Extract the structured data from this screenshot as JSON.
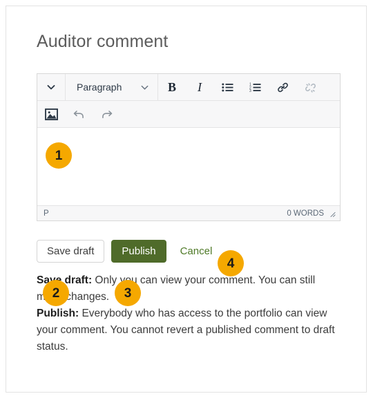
{
  "page": {
    "title": "Auditor comment"
  },
  "editor": {
    "toolbar_row1": [
      {
        "name": "block-collapse-toggle",
        "icon": "chevron-down-icon",
        "label": ""
      },
      {
        "name": "paragraph-format-select",
        "icon": "chevron-down-icon",
        "label": "Paragraph"
      },
      {
        "name": "bold-button",
        "icon": "bold-icon",
        "label": "B"
      },
      {
        "name": "italic-button",
        "icon": "italic-icon",
        "label": "I"
      },
      {
        "name": "bulleted-list-button",
        "icon": "bulleted-list-icon",
        "label": ""
      },
      {
        "name": "numbered-list-button",
        "icon": "numbered-list-icon",
        "label": ""
      },
      {
        "name": "insert-link-button",
        "icon": "link-icon",
        "label": ""
      },
      {
        "name": "unlink-button",
        "icon": "unlink-icon",
        "label": ""
      }
    ],
    "toolbar_row2": [
      {
        "name": "insert-image-button",
        "icon": "image-icon",
        "label": ""
      },
      {
        "name": "undo-button",
        "icon": "undo-icon",
        "label": ""
      },
      {
        "name": "redo-button",
        "icon": "redo-icon",
        "label": ""
      }
    ],
    "textarea_value": "",
    "textarea_placeholder": "",
    "status": {
      "element_path": "P",
      "word_count": "0 WORDS",
      "resize_grip": "resize-grip-icon"
    }
  },
  "actions": {
    "save_draft_label": "Save draft",
    "publish_label": "Publish",
    "cancel_label": "Cancel"
  },
  "callouts": [
    {
      "number": "1",
      "target": "editor-textarea"
    },
    {
      "number": "2",
      "target": "save-draft-button"
    },
    {
      "number": "3",
      "target": "publish-button"
    },
    {
      "number": "4",
      "target": "cancel-link"
    }
  ],
  "description": {
    "save_draft_term": "Save draft:",
    "save_draft_text": " Only you can view your comment. You can still make changes.",
    "publish_term": "Publish:",
    "publish_text": " Everybody who has access to the portfolio can view your comment. You cannot revert a published comment to draft status."
  },
  "colors": {
    "badge_background": "#f5a800",
    "publish_background": "#4f6b2a",
    "cancel_text": "#4f7a28",
    "page_border": "#e2e2e2",
    "toolbar_background": "#f7f7f8"
  }
}
